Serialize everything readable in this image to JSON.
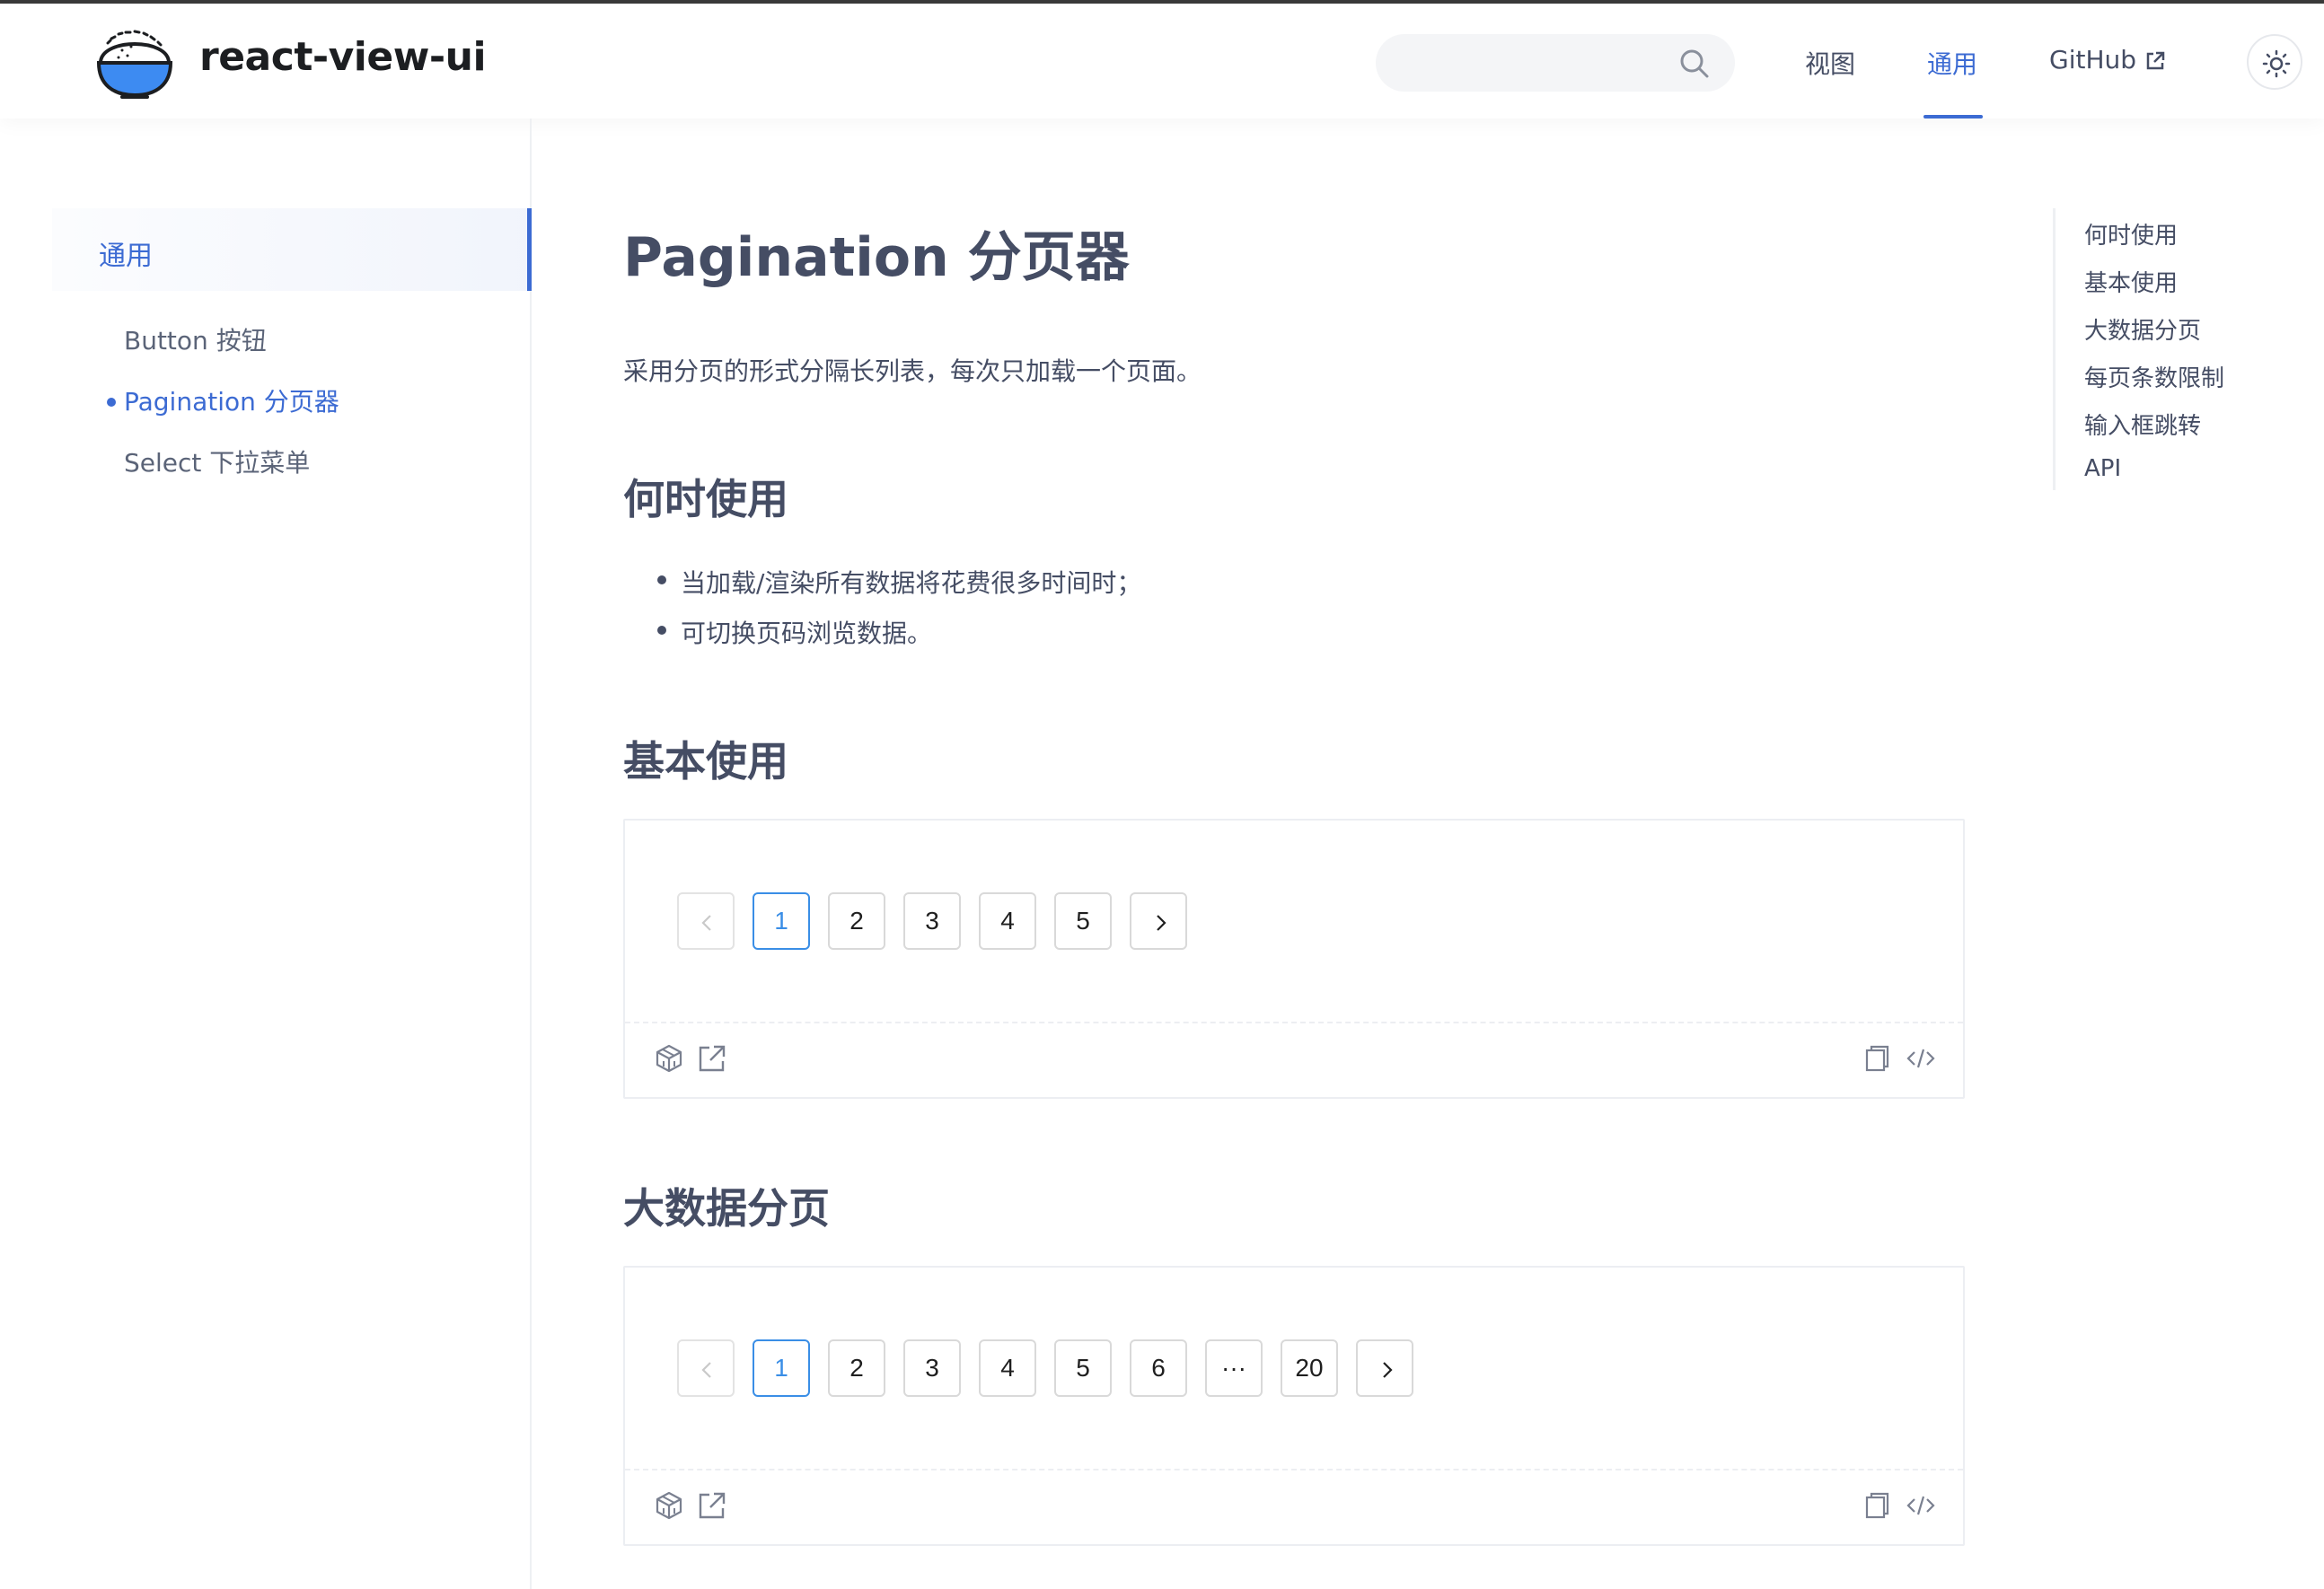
{
  "header": {
    "brand": "react-view-ui",
    "search_placeholder": "",
    "nav": [
      "视图",
      "通用",
      "GitHub"
    ],
    "active_nav": "通用",
    "icons": [
      "logo-rice-bowl",
      "search-icon",
      "external-link-icon",
      "sun-icon"
    ]
  },
  "sidebar": {
    "group": "通用",
    "items": [
      "Button 按钮",
      "Pagination 分页器",
      "Select 下拉菜单"
    ],
    "active_item": "Pagination 分页器"
  },
  "content": {
    "title": "Pagination 分页器",
    "intro": "采用分页的形式分隔长列表，每次只加载一个页面。",
    "sections": {
      "when": {
        "title": "何时使用",
        "items": [
          "当加载/渲染所有数据将花费很多时间时；",
          "可切换页码浏览数据。"
        ]
      },
      "basic": {
        "title": "基本使用"
      },
      "big": {
        "title": "大数据分页"
      }
    }
  },
  "demos": {
    "basic": {
      "pages": [
        "1",
        "2",
        "3",
        "4",
        "5"
      ],
      "current": "1"
    },
    "big": {
      "pages": [
        "1",
        "2",
        "3",
        "4",
        "5",
        "6",
        "···",
        "20"
      ],
      "current": "1"
    },
    "toolbar_icons": [
      "codesandbox-icon",
      "open-external-icon",
      "copy-icon",
      "code-icon"
    ]
  },
  "toc": [
    "何时使用",
    "基本使用",
    "大数据分页",
    "每页条数限制",
    "输入框跳转",
    "API"
  ],
  "colors": {
    "accent": "#3c6bd3",
    "text": "#454d64",
    "pager_active": "#3a8ee6",
    "logo_blue": "#3d8bf2"
  }
}
